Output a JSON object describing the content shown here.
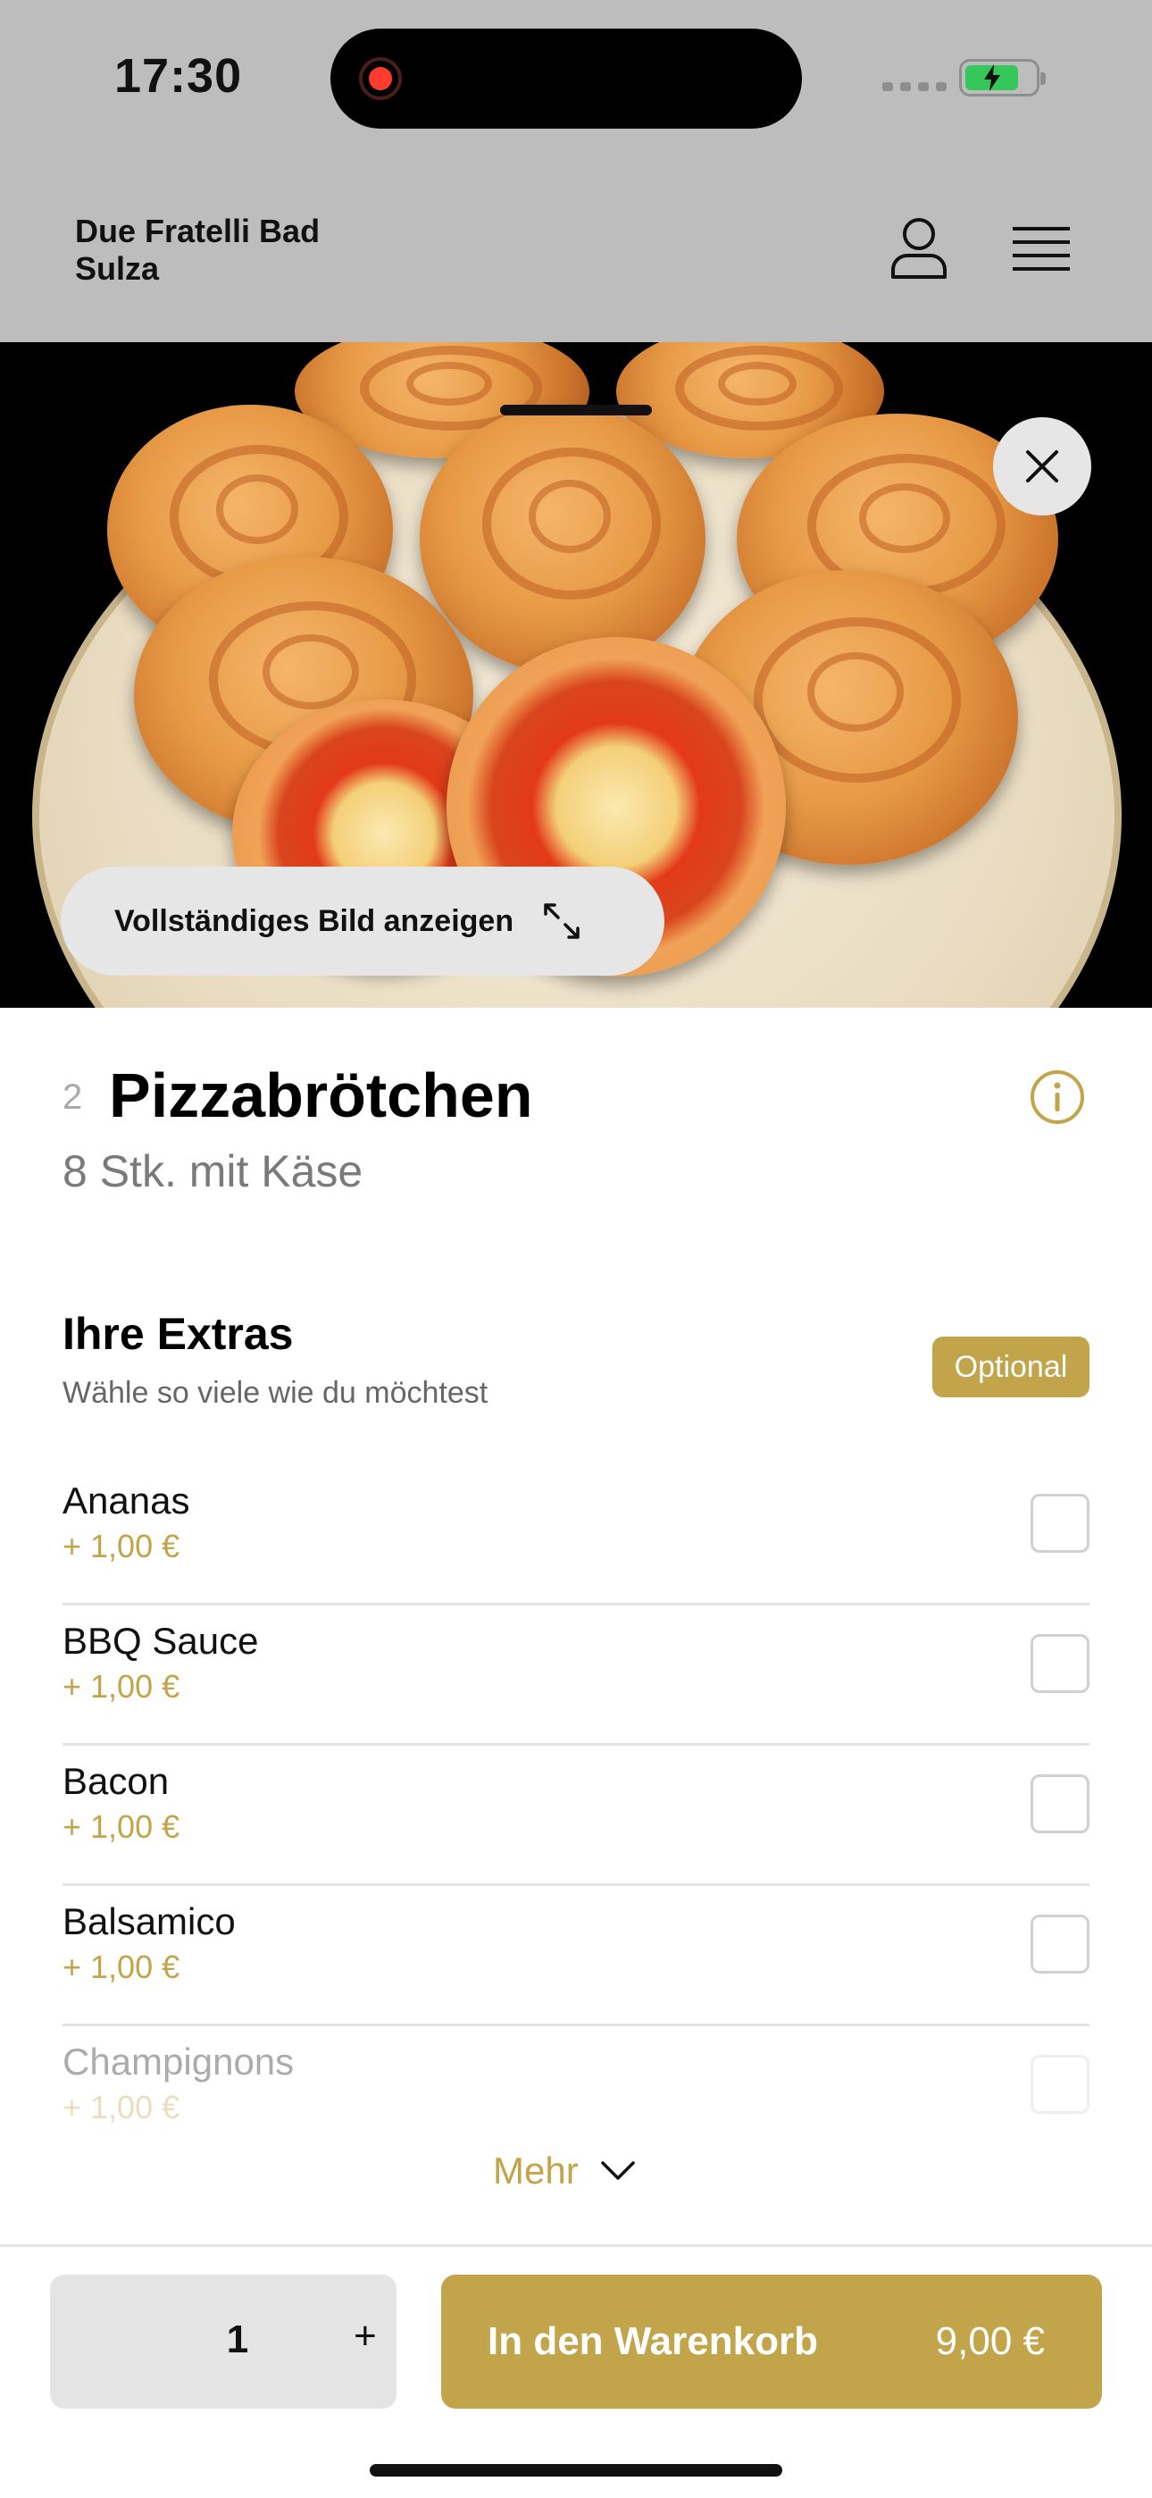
{
  "status_bar": {
    "time": "17:30",
    "icons": [
      "recording-icon",
      "signal-icon",
      "battery-charging-icon"
    ]
  },
  "header": {
    "restaurant_name": "Due Fratelli Bad Sulza",
    "icons": [
      "user-icon",
      "hamburger-menu-icon"
    ]
  },
  "hero": {
    "close_icon": "close-icon",
    "full_image_label": "Vollständiges Bild anzeigen",
    "expand_icon": "expand-icon"
  },
  "item": {
    "number": "2",
    "title": "Pizzabrötchen",
    "subtitle": "8 Stk. mit Käse",
    "info_icon": "info-icon"
  },
  "extras": {
    "title": "Ihre Extras",
    "hint": "Wähle so viele wie du möchtest",
    "badge": "Optional",
    "items": [
      {
        "name": "Ananas",
        "price": "+ 1,00 €",
        "checked": false
      },
      {
        "name": "BBQ Sauce",
        "price": "+ 1,00 €",
        "checked": false
      },
      {
        "name": "Bacon",
        "price": "+ 1,00 €",
        "checked": false
      },
      {
        "name": "Balsamico",
        "price": "+ 1,00 €",
        "checked": false
      },
      {
        "name": "Champignons",
        "price": "+ 1,00 €",
        "checked": false
      }
    ],
    "more_label": "Mehr"
  },
  "footer": {
    "quantity": "1",
    "plus": "+",
    "cart_label": "In den Warenkorb",
    "cart_price": "9,00 €"
  },
  "colors": {
    "accent": "#c2a44a",
    "header_bg": "#bdbdbd",
    "button_gray": "#e4e4e4"
  }
}
